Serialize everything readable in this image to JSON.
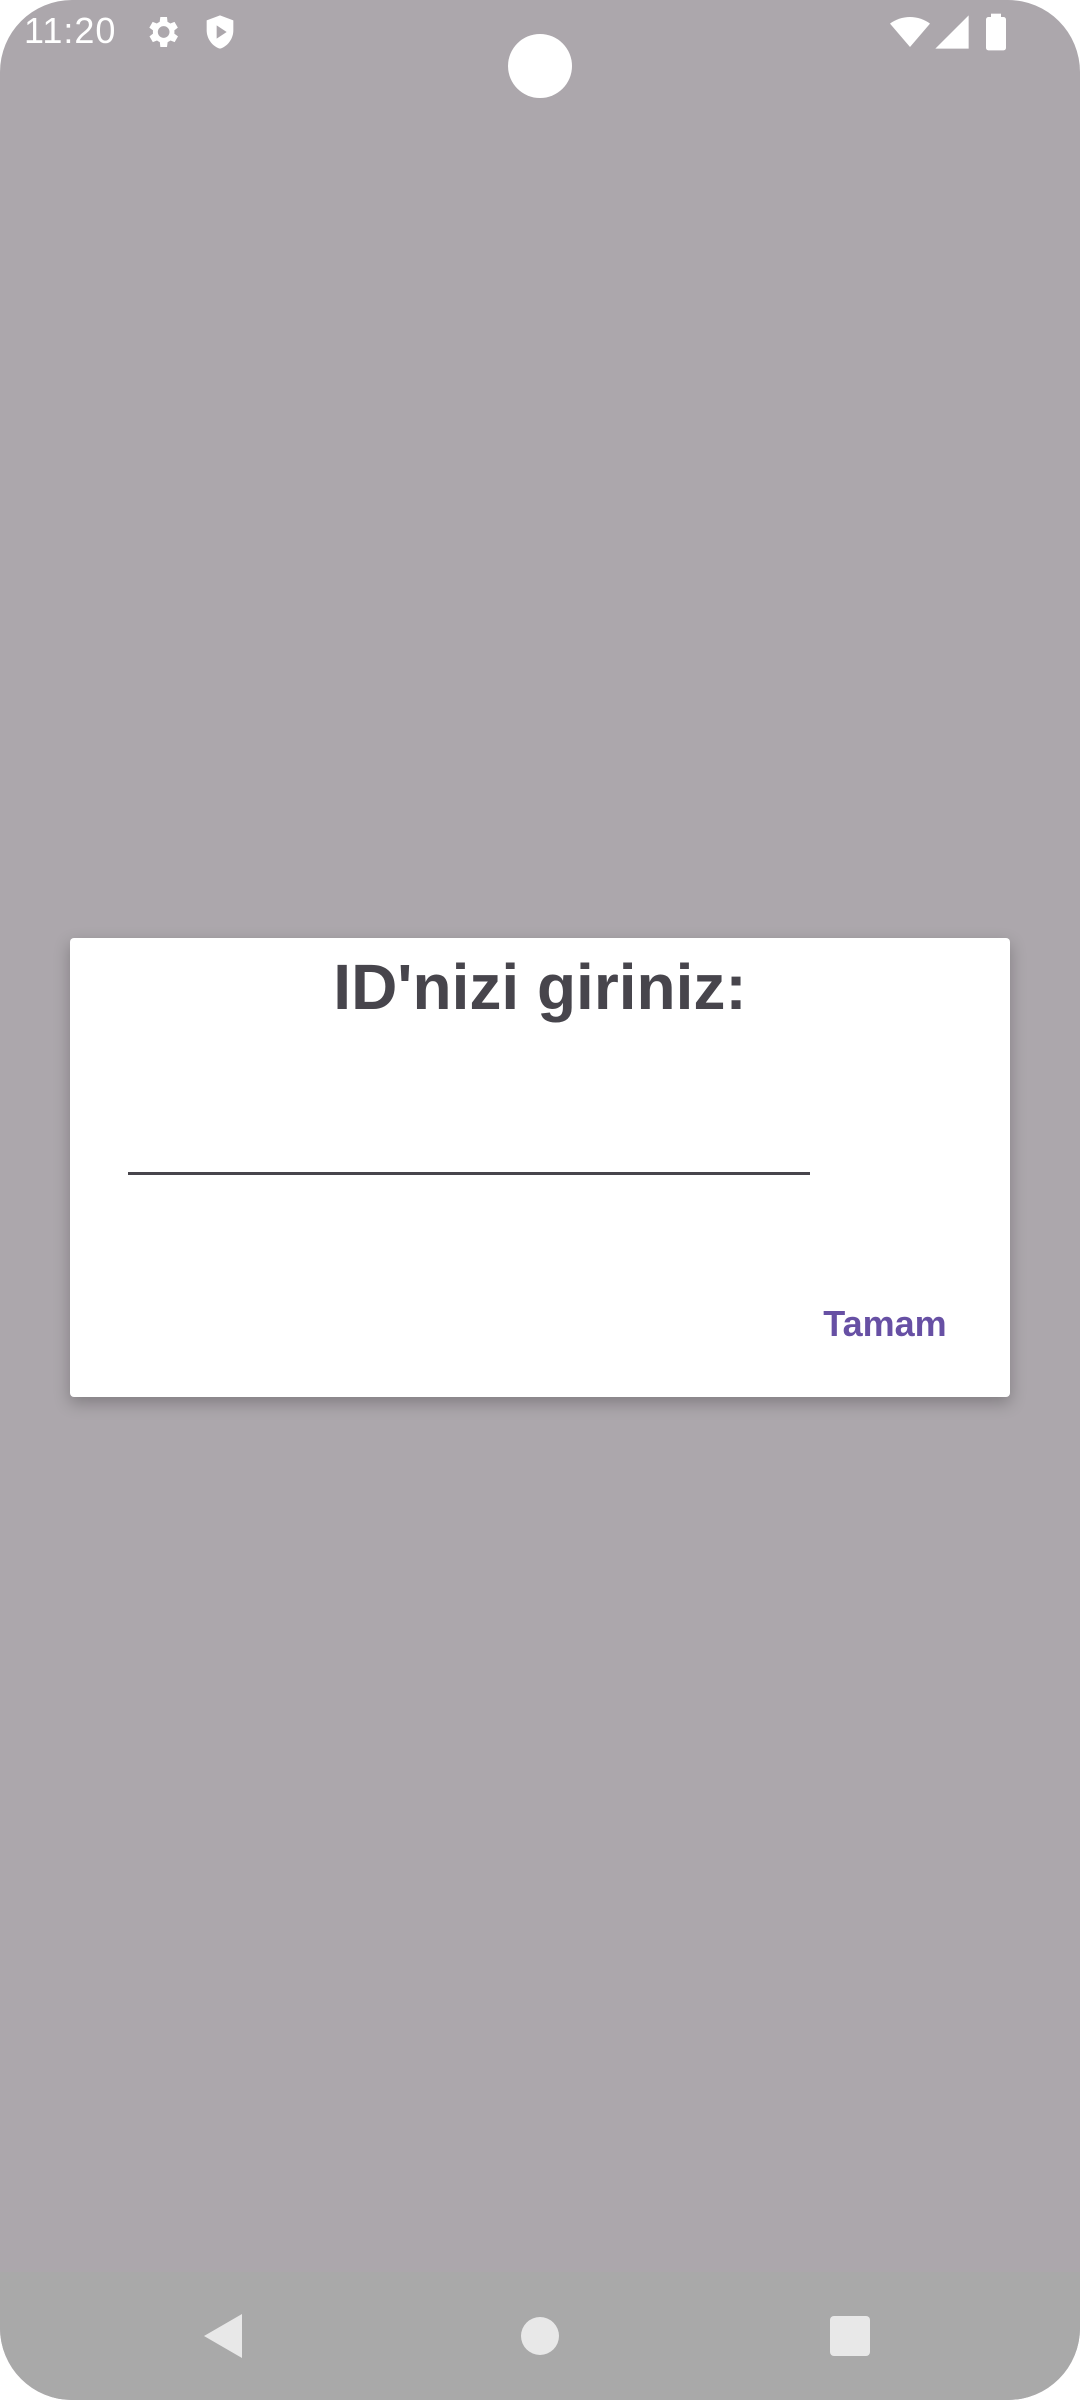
{
  "status_bar": {
    "time": "11:20",
    "left_icons": [
      "gear-icon",
      "shield-play-icon"
    ],
    "right_icons": [
      "wifi-icon",
      "cellular-signal-icon",
      "battery-icon"
    ]
  },
  "dialog": {
    "title": "ID'nizi giriniz:",
    "input": {
      "value": "",
      "placeholder": ""
    },
    "ok_label": "Tamam"
  },
  "nav_bar": {
    "icons": [
      "back-icon",
      "home-icon",
      "recents-icon"
    ]
  },
  "colors": {
    "scrim_background": "#aca7ac",
    "dialog_background": "#ffffff",
    "title_text": "#47454c",
    "accent": "#6750a4",
    "nav_background": "#a9a9a9"
  }
}
